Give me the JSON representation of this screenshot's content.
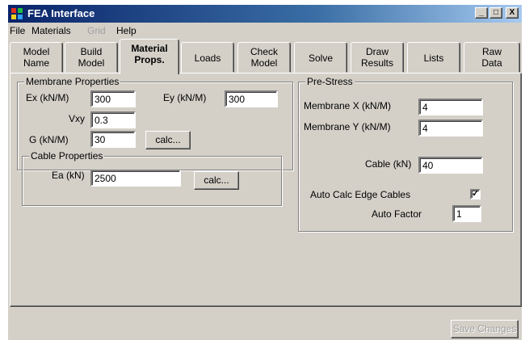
{
  "window": {
    "title": "FEA Interface",
    "controls": {
      "minimize": "_",
      "maximize": "□",
      "close": "X"
    }
  },
  "menu": [
    {
      "label": "File",
      "enabled": true
    },
    {
      "label": "Materials",
      "enabled": true
    },
    {
      "label": "Grid",
      "enabled": false
    },
    {
      "label": "Help",
      "enabled": true
    }
  ],
  "tabs": [
    {
      "line1": "Model",
      "line2": "Name"
    },
    {
      "line1": "Build",
      "line2": "Model"
    },
    {
      "line1": "Material",
      "line2": "Props.",
      "active": true
    },
    {
      "line1": "Loads",
      "line2": ""
    },
    {
      "line1": "Check",
      "line2": "Model"
    },
    {
      "line1": "Solve",
      "line2": ""
    },
    {
      "line1": "Draw",
      "line2": "Results"
    },
    {
      "line1": "Lists",
      "line2": ""
    },
    {
      "line1": "Raw",
      "line2": "Data"
    }
  ],
  "membrane": {
    "title": "Membrane Properties",
    "ex_label": "Ex (kN/M)",
    "ex_value": "300",
    "ey_label": "Ey (kN/M)",
    "ey_value": "300",
    "vxy_label": "Vxy",
    "vxy_value": "0.3",
    "g_label": "G (kN/M)",
    "g_value": "30",
    "calc_label": "calc..."
  },
  "cable": {
    "title": "Cable Properties",
    "ea_label": "Ea (kN)",
    "ea_value": "2500",
    "calc_label": "calc..."
  },
  "prestress": {
    "title": "Pre-Stress",
    "mx_label": "Membrane X (kN/M)",
    "mx_value": "4",
    "my_label": "Membrane Y (kN/M)",
    "my_value": "4",
    "cable_label": "Cable (kN)",
    "cable_value": "40",
    "auto_calc_label": "Auto Calc Edge Cables",
    "auto_calc_checked": true,
    "auto_factor_label": "Auto Factor",
    "auto_factor_value": "1"
  },
  "footer": {
    "save_label": "Save Changes",
    "save_enabled": false
  },
  "colors": {
    "face": "#d4d0c8",
    "titlebar": "#0a246a"
  }
}
